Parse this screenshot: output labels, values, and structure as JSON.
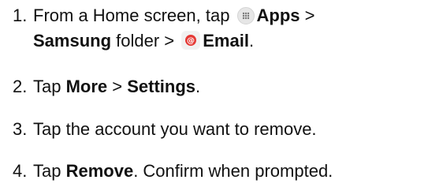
{
  "steps": [
    {
      "number": "1.",
      "line1_text1": "From a Home screen, tap ",
      "apps_icon": "apps-grid-icon",
      "apps_label": "Apps",
      "line1_text2": " >",
      "samsung_label": "Samsung",
      "line2_text1": " folder > ",
      "email_icon": "email-app-icon",
      "email_label": "Email",
      "line2_text2": "."
    },
    {
      "number": "2.",
      "text1": "Tap ",
      "bold1": "More",
      "text2": " > ",
      "bold2": "Settings",
      "text3": "."
    },
    {
      "number": "3.",
      "text1": "Tap the account you want to remove."
    },
    {
      "number": "4.",
      "text1": "Tap ",
      "bold1": "Remove",
      "text2": ". Confirm when prompted."
    }
  ],
  "colors": {
    "text": "#111111",
    "email_icon_accent": "#e53935"
  }
}
